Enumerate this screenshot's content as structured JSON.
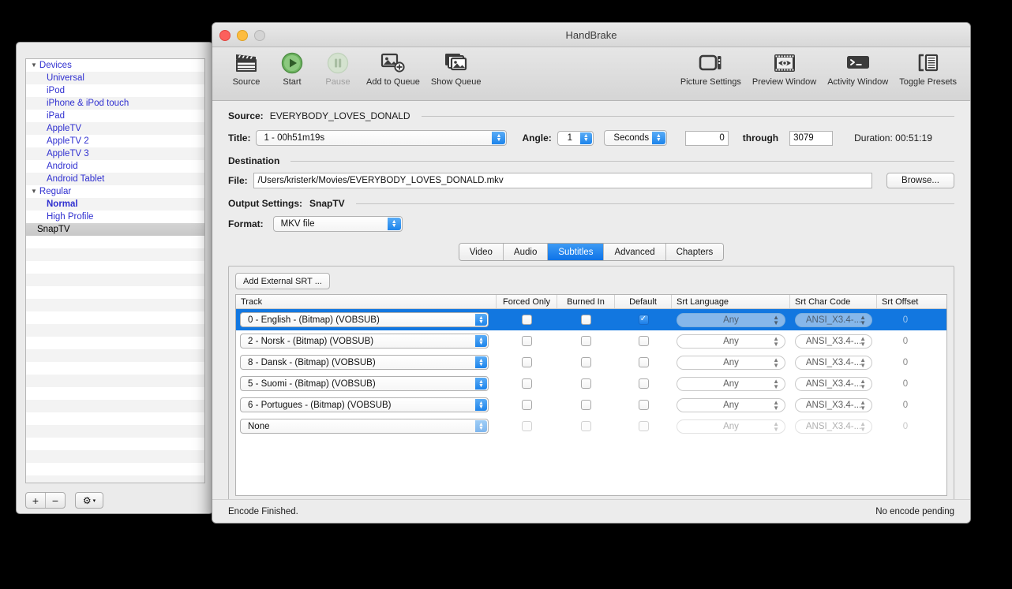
{
  "presets_window": {
    "items": [
      {
        "label": "Devices",
        "type": "group"
      },
      {
        "label": "Universal",
        "type": "child"
      },
      {
        "label": "iPod",
        "type": "child"
      },
      {
        "label": "iPhone & iPod touch",
        "type": "child"
      },
      {
        "label": "iPad",
        "type": "child"
      },
      {
        "label": "AppleTV",
        "type": "child"
      },
      {
        "label": "AppleTV 2",
        "type": "child"
      },
      {
        "label": "AppleTV 3",
        "type": "child"
      },
      {
        "label": "Android",
        "type": "child"
      },
      {
        "label": "Android Tablet",
        "type": "child"
      },
      {
        "label": "Regular",
        "type": "group"
      },
      {
        "label": "Normal",
        "type": "child-bold"
      },
      {
        "label": "High Profile",
        "type": "child"
      },
      {
        "label": "SnapTV",
        "type": "selected"
      }
    ],
    "disclosure_glyph": "▼",
    "add_label": "+",
    "remove_label": "−",
    "gear_label": "⚙",
    "gear_chevron": "▾"
  },
  "window": {
    "title": "HandBrake"
  },
  "toolbar": {
    "left": [
      {
        "label": "Source",
        "icon": "film-clapper-icon",
        "disabled": false
      },
      {
        "label": "Start",
        "icon": "play-icon",
        "disabled": false
      },
      {
        "label": "Pause",
        "icon": "pause-icon",
        "disabled": true
      },
      {
        "label": "Add to Queue",
        "icon": "add-to-queue-icon",
        "disabled": false
      },
      {
        "label": "Show Queue",
        "icon": "show-queue-icon",
        "disabled": false
      }
    ],
    "right": [
      {
        "label": "Picture Settings",
        "icon": "television-icon"
      },
      {
        "label": "Preview Window",
        "icon": "preview-eye-icon"
      },
      {
        "label": "Activity Window",
        "icon": "terminal-icon"
      },
      {
        "label": "Toggle Presets",
        "icon": "toggle-presets-icon"
      }
    ]
  },
  "source": {
    "label": "Source:",
    "name": "EVERYBODY_LOVES_DONALD",
    "title_label": "Title:",
    "title_value": "1 - 00h51m19s",
    "angle_label": "Angle:",
    "angle_value": "1",
    "range_unit": "Seconds",
    "start_value": "0",
    "through_label": "through",
    "end_value": "3079",
    "duration": "Duration: 00:51:19"
  },
  "destination": {
    "header": "Destination",
    "file_label": "File:",
    "file_value": "/Users/kristerk/Movies/EVERYBODY_LOVES_DONALD.mkv",
    "browse_label": "Browse..."
  },
  "output": {
    "header": "Output Settings:",
    "preset": "SnapTV",
    "format_label": "Format:",
    "format_value": "MKV file"
  },
  "tabs": [
    {
      "label": "Video",
      "active": false
    },
    {
      "label": "Audio",
      "active": false
    },
    {
      "label": "Subtitles",
      "active": true
    },
    {
      "label": "Advanced",
      "active": false
    },
    {
      "label": "Chapters",
      "active": false
    }
  ],
  "subtitles": {
    "add_srt_label": "Add External SRT ...",
    "columns": [
      "Track",
      "Forced Only",
      "Burned In",
      "Default",
      "Srt Language",
      "Srt Char Code",
      "Srt Offset"
    ],
    "rows": [
      {
        "track": "0 - English - (Bitmap) (VOBSUB)",
        "forced_only": false,
        "burned_in": false,
        "default": true,
        "srt_language": "Any",
        "srt_char_code": "ANSI_X3.4-...",
        "srt_offset": "0",
        "selected": true,
        "disabled": false
      },
      {
        "track": "2 - Norsk - (Bitmap) (VOBSUB)",
        "forced_only": false,
        "burned_in": false,
        "default": false,
        "srt_language": "Any",
        "srt_char_code": "ANSI_X3.4-...",
        "srt_offset": "0",
        "selected": false,
        "disabled": false
      },
      {
        "track": "8 - Dansk - (Bitmap) (VOBSUB)",
        "forced_only": false,
        "burned_in": false,
        "default": false,
        "srt_language": "Any",
        "srt_char_code": "ANSI_X3.4-...",
        "srt_offset": "0",
        "selected": false,
        "disabled": false
      },
      {
        "track": "5 - Suomi - (Bitmap) (VOBSUB)",
        "forced_only": false,
        "burned_in": false,
        "default": false,
        "srt_language": "Any",
        "srt_char_code": "ANSI_X3.4-...",
        "srt_offset": "0",
        "selected": false,
        "disabled": false
      },
      {
        "track": "6 - Portugues - (Bitmap) (VOBSUB)",
        "forced_only": false,
        "burned_in": false,
        "default": false,
        "srt_language": "Any",
        "srt_char_code": "ANSI_X3.4-...",
        "srt_offset": "0",
        "selected": false,
        "disabled": false
      },
      {
        "track": "None",
        "forced_only": false,
        "burned_in": false,
        "default": false,
        "srt_language": "Any",
        "srt_char_code": "ANSI_X3.4-...",
        "srt_offset": "0",
        "selected": false,
        "disabled": true
      }
    ]
  },
  "statusbar": {
    "left": "Encode Finished.",
    "right": "No encode pending"
  },
  "colors": {
    "accent_blue": "#1277e0",
    "tab_blue": "#0e73e8",
    "window_bg": "#ececec",
    "link_blue": "#2f2fd0"
  }
}
